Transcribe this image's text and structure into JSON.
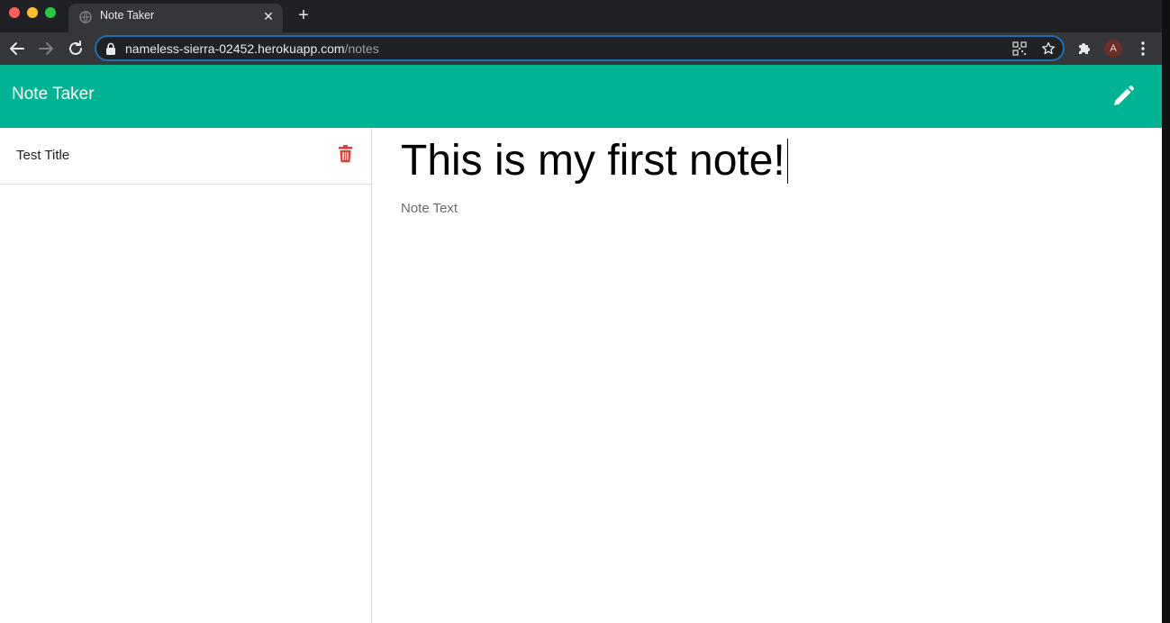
{
  "browser": {
    "tab": {
      "title": "Note Taker",
      "close_label": "✕"
    },
    "new_tab_label": "+",
    "address": {
      "host": "nameless-sierra-02452.herokuapp.com",
      "path": "/notes"
    },
    "profile_initial": "A"
  },
  "app": {
    "brand": "Note Taker",
    "accent_color": "#00b393",
    "delete_color": "#e53935"
  },
  "sidebar": {
    "notes": [
      {
        "title": "Test Title"
      }
    ]
  },
  "editor": {
    "title_value": "This is my first note!",
    "text_placeholder": "Note Text"
  }
}
